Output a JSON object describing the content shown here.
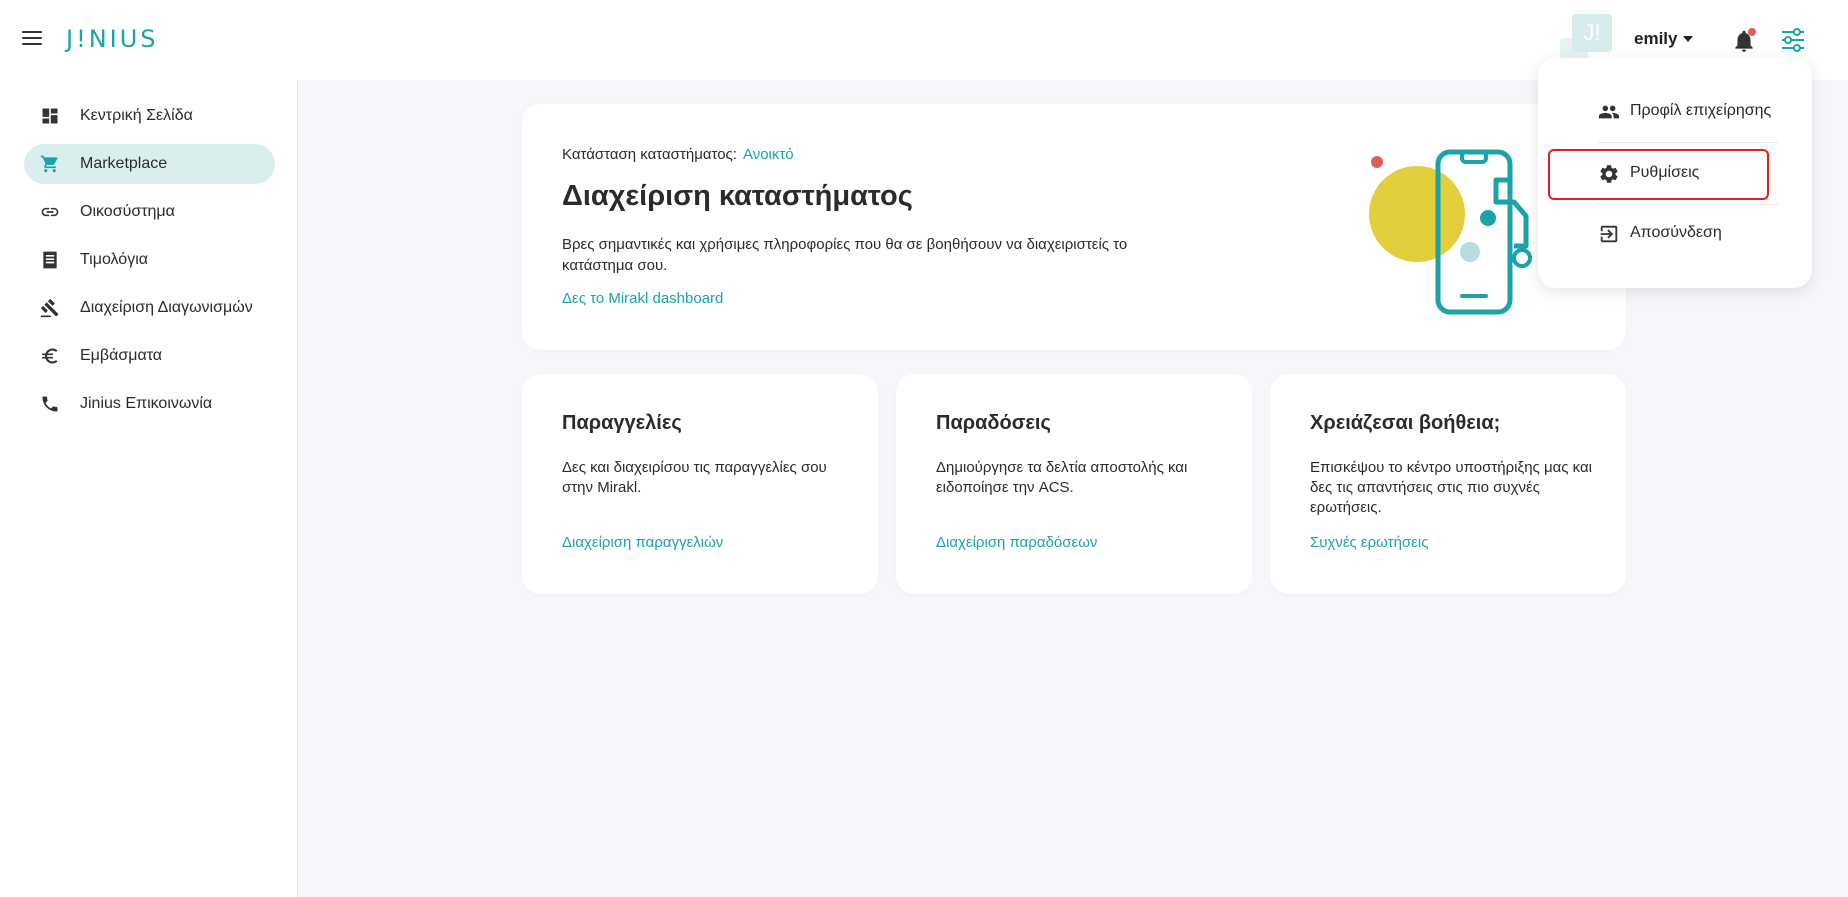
{
  "header": {
    "logo": "J!NIUS",
    "avatar_text": "J!",
    "username": "emily",
    "colors": {
      "accent": "#1ba3a8",
      "notification_dot": "#e25c5c"
    }
  },
  "sidebar": {
    "items": [
      {
        "label": "Κεντρική Σελίδα",
        "icon": "dashboard-icon"
      },
      {
        "label": "Marketplace",
        "icon": "cart-icon",
        "active": true
      },
      {
        "label": "Οικοσύστημα",
        "icon": "link-icon"
      },
      {
        "label": "Τιμολόγια",
        "icon": "receipt-icon"
      },
      {
        "label": "Διαχείριση Διαγωνισμών",
        "icon": "gavel-icon"
      },
      {
        "label": "Εμβάσματα",
        "icon": "euro-icon"
      },
      {
        "label": "Jinius Επικοινωνία",
        "icon": "phone-icon"
      }
    ]
  },
  "hero": {
    "status_label": "Κατάσταση καταστήματος:",
    "status_value": "Ανοικτό",
    "title": "Διαχείριση καταστήματος",
    "description": "Βρες σημαντικές και χρήσιμες πληροφορίες που θα σε βοηθήσουν να διαχειριστείς το κατάστημα σου.",
    "link": "Δες το Mirakl dashboard"
  },
  "cards": [
    {
      "title": "Παραγγελίες",
      "text": "Δες και διαχειρίσου τις παραγγελίες σου στην Mirakl.",
      "link": "Διαχείριση παραγγελιών"
    },
    {
      "title": "Παραδόσεις",
      "text": "Δημιούργησε τα δελτία αποστολής και ειδοποίησε την ACS.",
      "link": "Διαχείριση παραδόσεων"
    },
    {
      "title": "Χρειάζεσαι βοήθεια;",
      "text": "Επισκέψου το κέντρο υποστήριξης μας και δες τις απαντήσεις στις πιο συχνές ερωτήσεις.",
      "link": "Συχνές ερωτήσεις"
    }
  ],
  "dropdown": {
    "items": [
      {
        "label": "Προφίλ επιχείρησης",
        "icon": "people-icon"
      },
      {
        "label": "Ρυθμίσεις",
        "icon": "gear-icon",
        "highlighted": true
      },
      {
        "label": "Αποσύνδεση",
        "icon": "logout-icon"
      }
    ]
  }
}
